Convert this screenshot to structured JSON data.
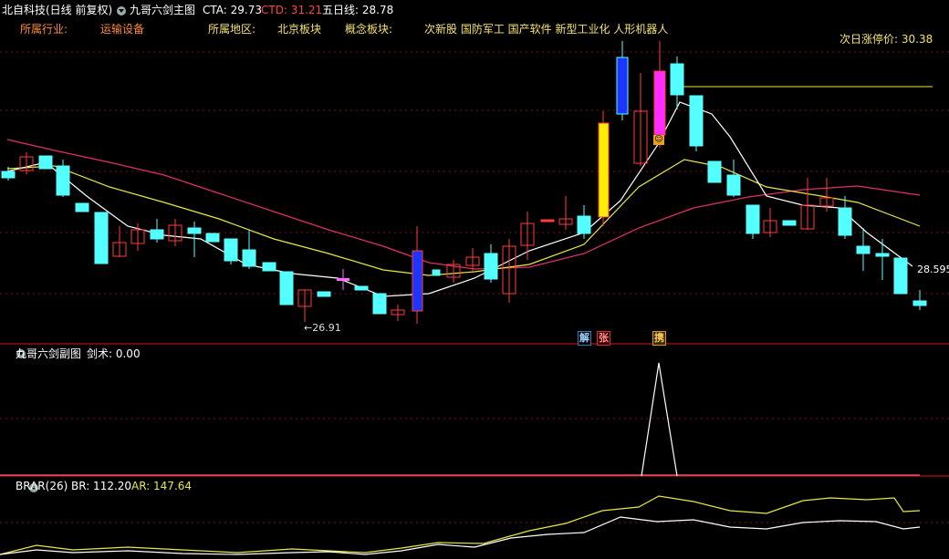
{
  "header": {
    "stock_title": "北自科技(日线 前复权)",
    "indicator_name": "九哥六剑主图",
    "cta_label": "CTA: 29.73",
    "ctd_label": "CTD: 31.21",
    "ma5_label": "五日线: 28.78"
  },
  "info": {
    "industry_label": "所属行业:",
    "industry_value": "运输设备",
    "region_label": "所属地区:",
    "region_value": "北京板块",
    "concept_label": "概念板块:",
    "concept_value": "次新股 国防军工 国产软件 新型工业化 人形机器人",
    "limit_label": "次日涨停价: 30.38"
  },
  "main_chart": {
    "price_high_label": "28.595",
    "price_low_label": "←26.91",
    "signals": [
      {
        "text": "解",
        "color": "#2a7fbf"
      },
      {
        "text": "张",
        "color": "#d03030"
      },
      {
        "text": "携",
        "color": "#d69a1a"
      }
    ],
    "colors": {
      "up": "#ff3b3b",
      "down": "#54ffff",
      "ma_fast": "#ffffff",
      "ma_mid": "#e8e840",
      "ma_slow": "#e0306a"
    }
  },
  "sub_chart1": {
    "title": "九哥六剑副图",
    "value_label": "剑术: 0.00"
  },
  "sub_chart2": {
    "title": "BRAR(26)",
    "br_label": "BR: 112.20",
    "ar_label": "AR: 147.64"
  }
}
